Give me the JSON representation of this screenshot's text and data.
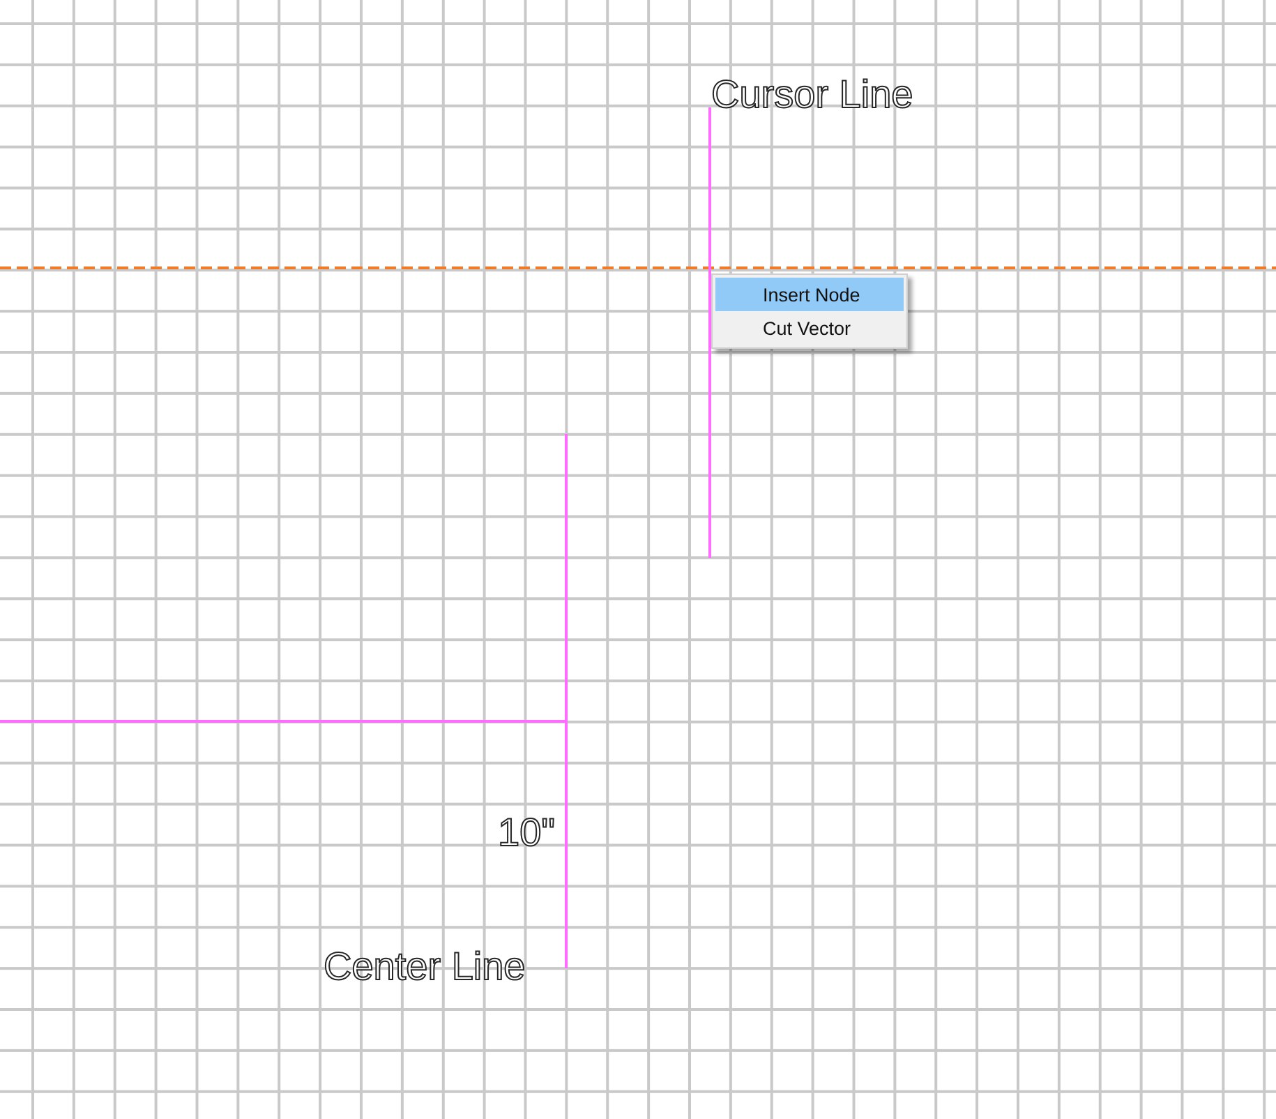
{
  "cursor_line": {
    "label": "Cursor Line"
  },
  "context_menu": {
    "items": [
      {
        "label": "Insert Node",
        "selected": true
      },
      {
        "label": "Cut Vector",
        "selected": false
      }
    ]
  },
  "dimension": {
    "label": "10\""
  },
  "center_line": {
    "label": "Center Line"
  }
}
